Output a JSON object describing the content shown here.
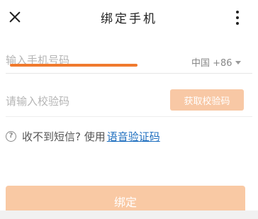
{
  "header": {
    "title": "绑定手机"
  },
  "phone": {
    "placeholder": "输入手机号码",
    "country_code": "中国 +86"
  },
  "verification": {
    "placeholder": "请输入校验码",
    "get_code_label": "获取校验码"
  },
  "help": {
    "icon_glyph": "?",
    "text": "收不到短信? 使用",
    "voice_link": "语音验证码"
  },
  "bind_button": {
    "label": "绑定"
  },
  "colors": {
    "accent_light": "#f9c9a4",
    "link": "#1f6fbf",
    "annotation_underline": "#f07a2e"
  },
  "icons": {
    "close": "close-icon",
    "more": "more-vertical-icon",
    "dropdown": "chevron-down-icon",
    "help": "help-circle-icon"
  }
}
